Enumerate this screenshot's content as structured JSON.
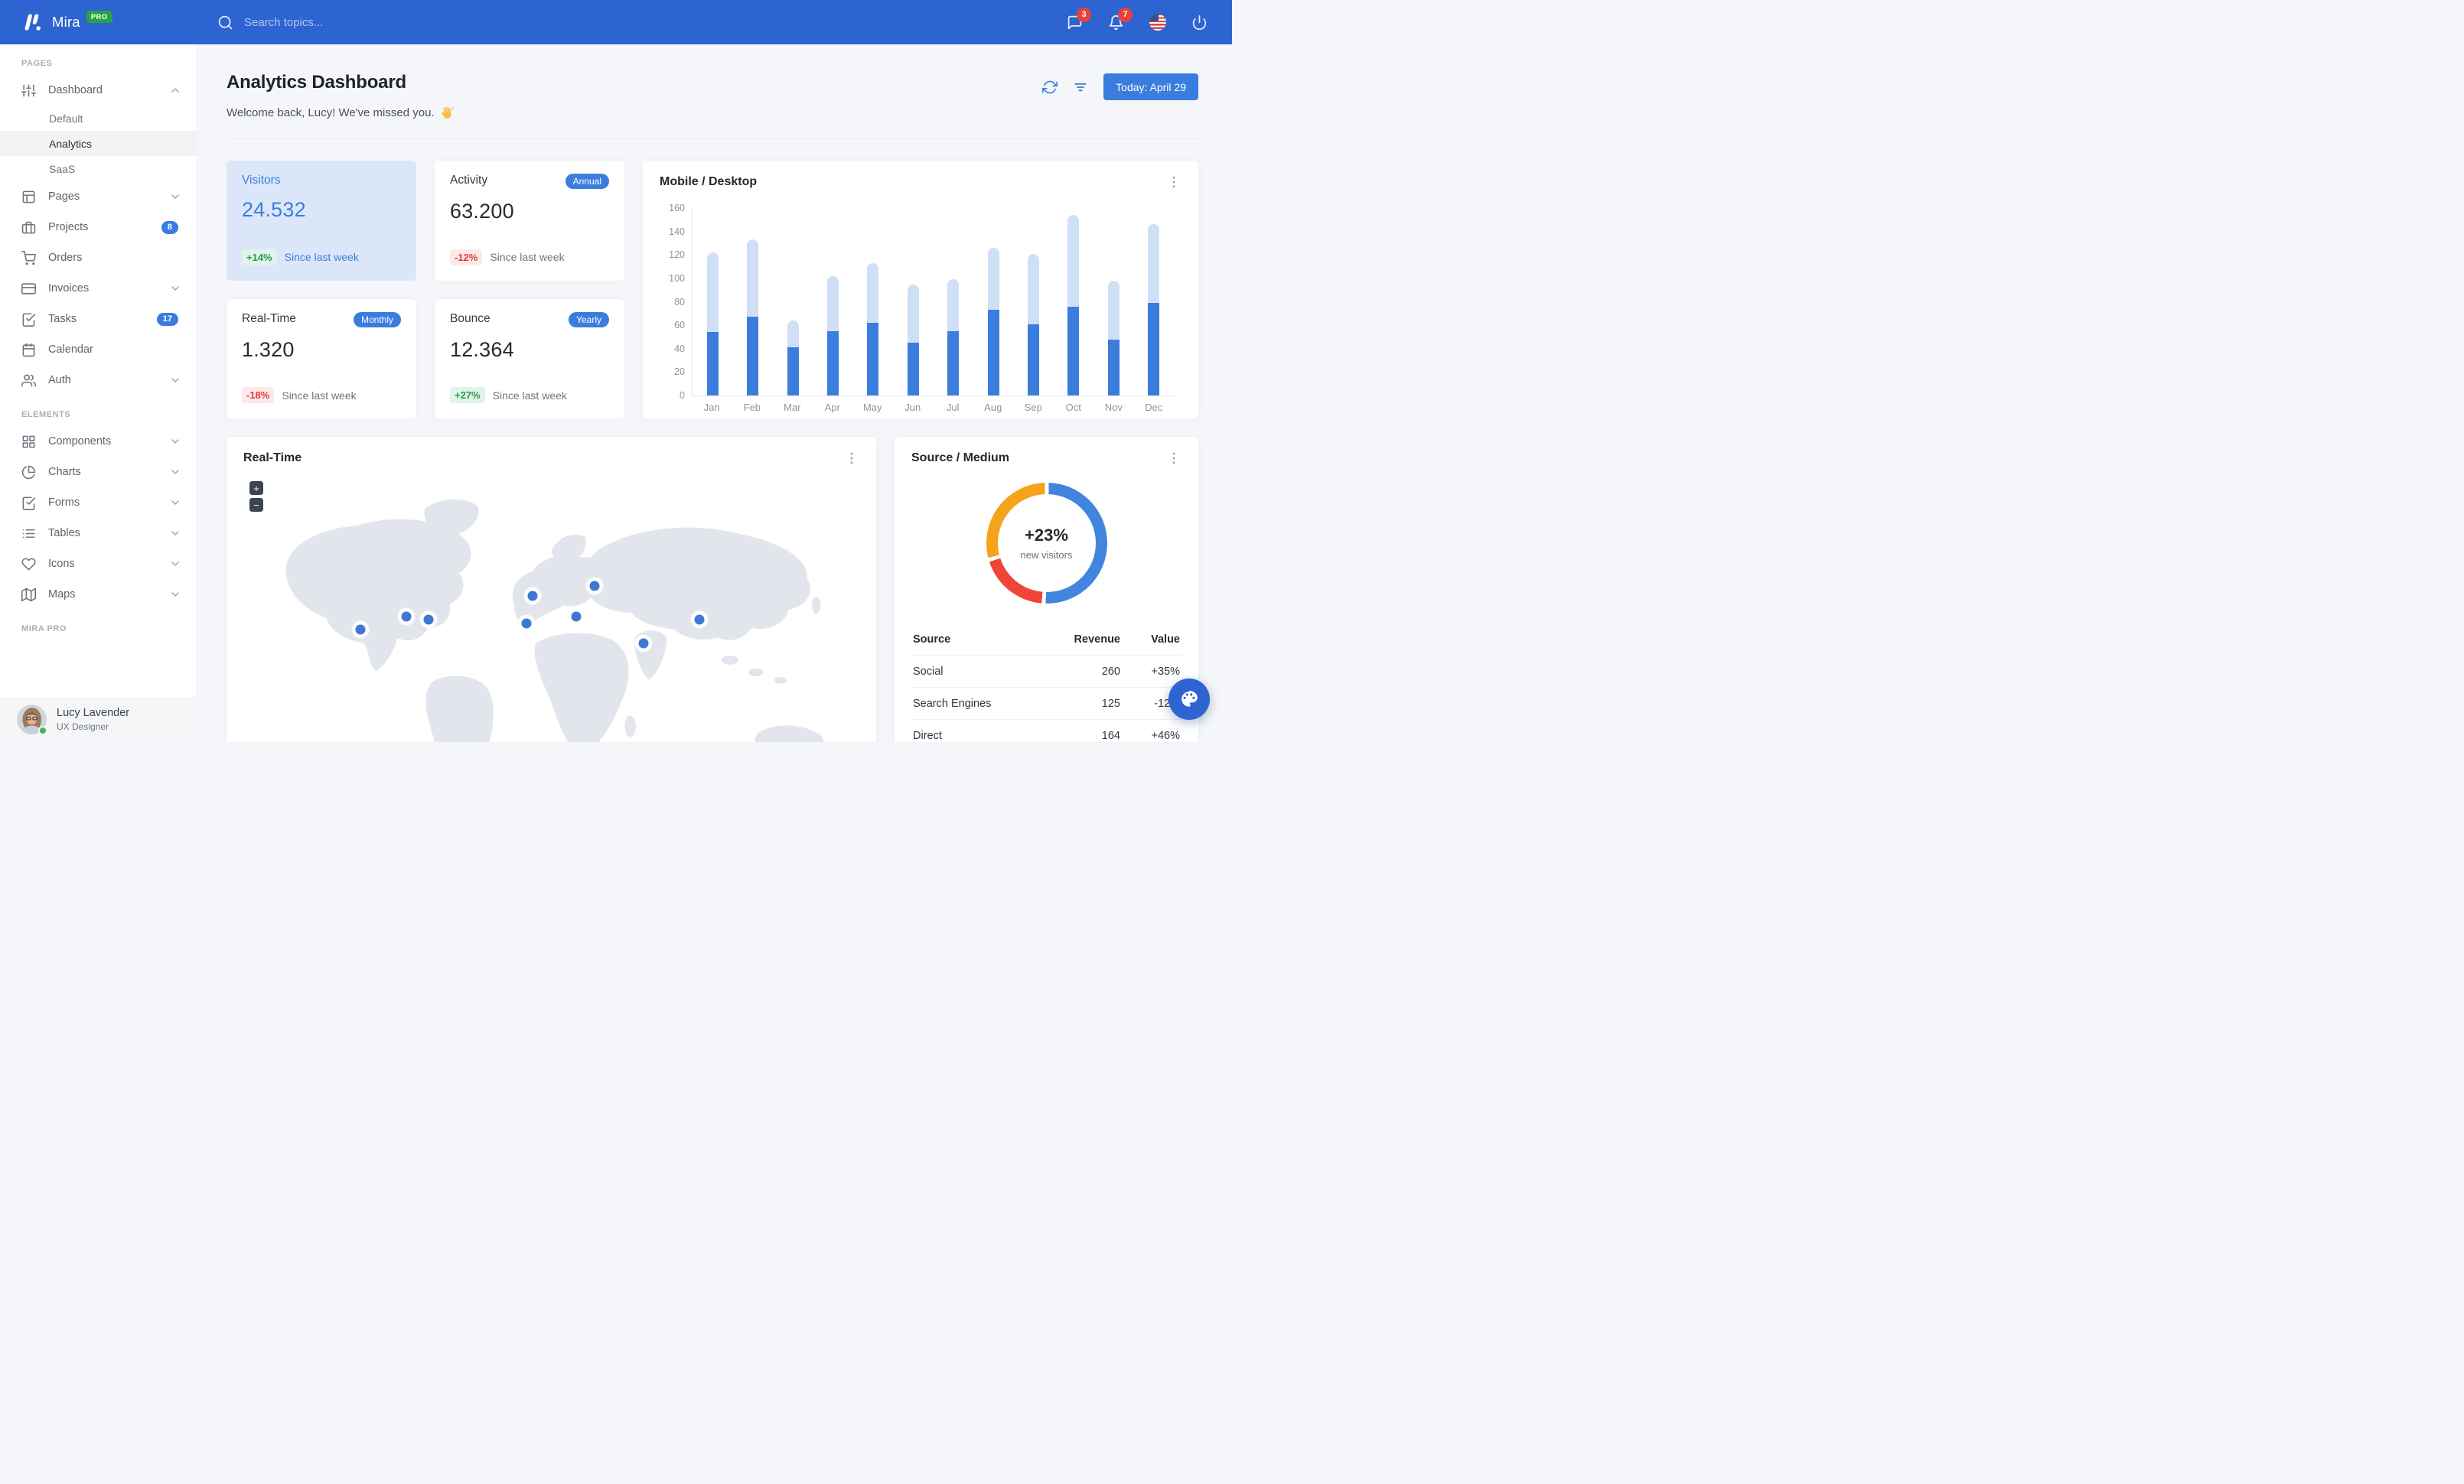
{
  "navbar": {
    "brand": "Mira",
    "brand_badge": "PRO",
    "search_placeholder": "Search topics...",
    "messages_count": "3",
    "notifications_count": "7"
  },
  "sidebar": {
    "sections": [
      {
        "label": "PAGES",
        "items": [
          {
            "label": "Dashboard",
            "icon": "sliders",
            "chevron": "up",
            "children": [
              {
                "label": "Default",
                "active": false
              },
              {
                "label": "Analytics",
                "active": true
              },
              {
                "label": "SaaS",
                "active": false
              }
            ]
          },
          {
            "label": "Pages",
            "icon": "layout",
            "chevron": "down"
          },
          {
            "label": "Projects",
            "icon": "briefcase",
            "badge": "8"
          },
          {
            "label": "Orders",
            "icon": "shopping-cart"
          },
          {
            "label": "Invoices",
            "icon": "credit-card",
            "chevron": "down"
          },
          {
            "label": "Tasks",
            "icon": "check-square",
            "badge": "17"
          },
          {
            "label": "Calendar",
            "icon": "calendar"
          },
          {
            "label": "Auth",
            "icon": "users",
            "chevron": "down"
          }
        ]
      },
      {
        "label": "ELEMENTS",
        "items": [
          {
            "label": "Components",
            "icon": "grid",
            "chevron": "down"
          },
          {
            "label": "Charts",
            "icon": "pie-chart",
            "chevron": "down"
          },
          {
            "label": "Forms",
            "icon": "check-square",
            "chevron": "down"
          },
          {
            "label": "Tables",
            "icon": "list",
            "chevron": "down"
          },
          {
            "label": "Icons",
            "icon": "heart",
            "chevron": "down"
          },
          {
            "label": "Maps",
            "icon": "map",
            "chevron": "down"
          }
        ]
      },
      {
        "label": "MIRA PRO",
        "items": []
      }
    ],
    "user": {
      "name": "Lucy Lavender",
      "role": "UX Designer"
    }
  },
  "header": {
    "title": "Analytics Dashboard",
    "subtitle": "Welcome back, Lucy! We've missed you.",
    "subtitle_emoji": "👋",
    "date_button": "Today: April 29"
  },
  "stats": [
    {
      "title": "Visitors",
      "value": "24.532",
      "delta": "+14%",
      "delta_type": "success",
      "note": "Since last week",
      "variant": "primary"
    },
    {
      "title": "Activity",
      "badge": "Annual",
      "value": "63.200",
      "delta": "-12%",
      "delta_type": "danger",
      "note": "Since last week"
    },
    {
      "title": "Real-Time",
      "badge": "Monthly",
      "value": "1.320",
      "delta": "-18%",
      "delta_type": "danger",
      "note": "Since last week"
    },
    {
      "title": "Bounce",
      "badge": "Yearly",
      "value": "12.364",
      "delta": "+27%",
      "delta_type": "success",
      "note": "Since last week"
    }
  ],
  "chart_data": [
    {
      "id": "mobile_desktop",
      "type": "bar",
      "stacked": true,
      "title": "Mobile / Desktop",
      "categories": [
        "Jan",
        "Feb",
        "Mar",
        "Apr",
        "May",
        "Jun",
        "Jul",
        "Aug",
        "Sep",
        "Oct",
        "Nov",
        "Dec"
      ],
      "series": [
        {
          "name": "Mobile",
          "color": "#3b7ddd",
          "values": [
            54,
            67,
            41,
            55,
            62,
            45,
            55,
            73,
            61,
            76,
            48,
            79
          ]
        },
        {
          "name": "Desktop",
          "color": "#cfdff6",
          "values": [
            68,
            66,
            23,
            47,
            51,
            50,
            44,
            53,
            60,
            78,
            50,
            67
          ]
        }
      ],
      "ylim": [
        0,
        160
      ],
      "yticks": [
        0,
        20,
        40,
        60,
        80,
        100,
        120,
        140,
        160
      ],
      "grid": false,
      "legend": "none"
    },
    {
      "id": "source_medium",
      "type": "donut",
      "title": "Source / Medium",
      "center_value": "+23%",
      "center_label": "new visitors",
      "slices": [
        {
          "color": "#4285de",
          "from_deg": 2,
          "to_deg": 181,
          "approx_pct": 50
        },
        {
          "color": "#ef4437",
          "from_deg": 185,
          "to_deg": 252,
          "approx_pct": 19
        },
        {
          "color": "#f5a31b",
          "from_deg": 256,
          "to_deg": 358,
          "approx_pct": 28
        }
      ]
    }
  ],
  "map": {
    "title": "Real-Time",
    "zoom_in_label": "+",
    "zoom_out_label": "−",
    "markers": [
      {
        "x": 19,
        "y": 46
      },
      {
        "x": 26.5,
        "y": 42
      },
      {
        "x": 30,
        "y": 43
      },
      {
        "x": 47,
        "y": 36
      },
      {
        "x": 46,
        "y": 44
      },
      {
        "x": 54,
        "y": 42
      },
      {
        "x": 57,
        "y": 33
      },
      {
        "x": 65,
        "y": 50
      },
      {
        "x": 74,
        "y": 43
      }
    ]
  },
  "source": {
    "title": "Source / Medium",
    "table": {
      "headers": [
        "Source",
        "Revenue",
        "Value"
      ],
      "rows": [
        {
          "source": "Social",
          "revenue": "260",
          "value": "+35%",
          "value_type": "success"
        },
        {
          "source": "Search Engines",
          "revenue": "125",
          "value": "-12%",
          "value_type": "danger"
        },
        {
          "source": "Direct",
          "revenue": "164",
          "value": "+46%",
          "value_type": "success"
        }
      ]
    }
  },
  "colors": {
    "navbar": "#2e64d1",
    "primary": "#3b7ddd",
    "success": "#22984f",
    "danger": "#e5383b",
    "bar_mobile": "#3b7ddd",
    "bar_desktop": "#cfdff6",
    "donut_blue": "#4285de",
    "donut_red": "#ef4437",
    "donut_orange": "#f5a31b",
    "badge_red": "#e8403a",
    "pro_green": "#26a248"
  }
}
